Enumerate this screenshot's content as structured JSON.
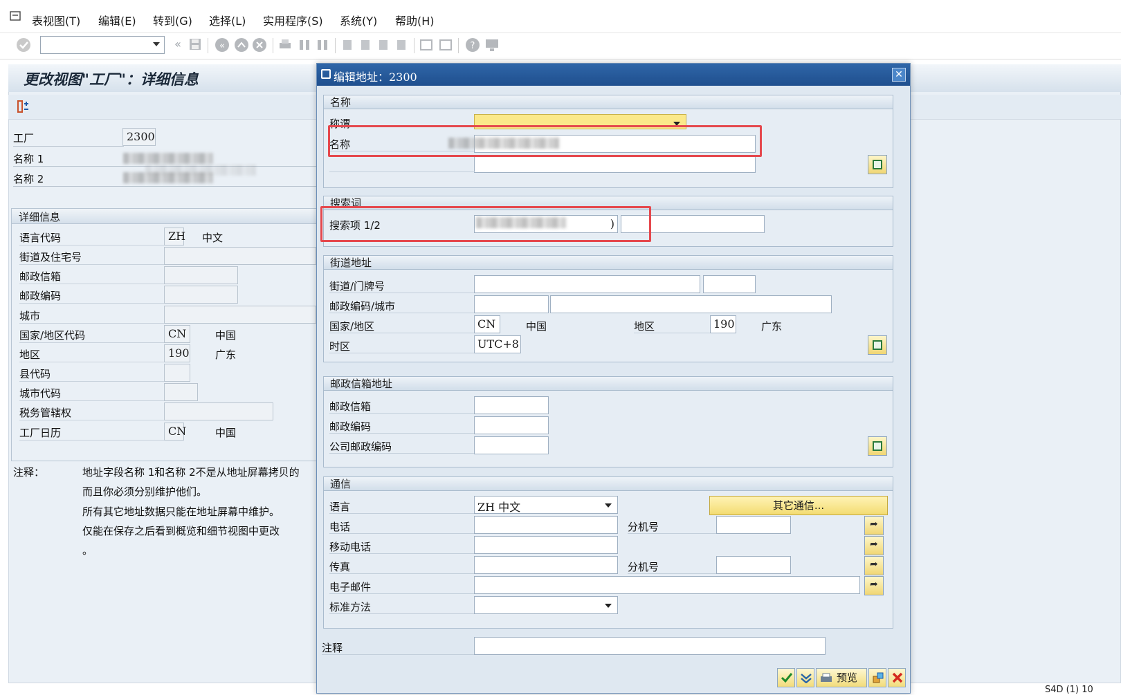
{
  "menubar": {
    "items": [
      "表视图(T)",
      "编辑(E)",
      "转到(G)",
      "选择(L)",
      "实用程序(S)",
      "系统(Y)",
      "帮助(H)"
    ]
  },
  "main": {
    "title": "更改视图\"工厂\"：详细信息",
    "plant_label": "工厂",
    "plant_value": "2300",
    "name1_label": "名称 1",
    "name2_label": "名称 2",
    "details": {
      "title": "详细信息",
      "language_label": "语言代码",
      "language_code": "ZH",
      "language_name": "中文",
      "street_label": "街道及住宅号",
      "pobox_label": "邮政信箱",
      "postal_label": "邮政编码",
      "city_label": "城市",
      "country_label": "国家/地区代码",
      "country_code": "CN",
      "country_name": "中国",
      "region_label": "地区",
      "region_code": "190",
      "region_name": "广东",
      "county_label": "县代码",
      "citycode_label": "城市代码",
      "tax_label": "税务管辖权",
      "calendar_label": "工厂日历",
      "calendar_code": "CN",
      "calendar_name": "中国"
    },
    "note_label": "注释：",
    "note_lines": [
      "地址字段名称 1和名称 2不是从地址屏幕拷贝的",
      "而且你必须分别维护他们。",
      "所有其它地址数据只能在地址屏幕中维护。",
      "仅能在保存之后看到概览和细节视图中更改",
      "。"
    ]
  },
  "dialog": {
    "title": "编辑地址：2300",
    "name_section": {
      "title": "名称",
      "salutation_label": "称谓",
      "name_label": "名称"
    },
    "search_section": {
      "title": "搜索词",
      "search_label": "搜索项 1/2",
      "search_value": ")"
    },
    "street_section": {
      "title": "街道地址",
      "street_label": "街道/门牌号",
      "postal_city_label": "邮政编码/城市",
      "country_label": "国家/地区",
      "country_code": "CN",
      "country_name": "中国",
      "region_label": "地区",
      "region_code": "190",
      "region_name": "广东",
      "timezone_label": "时区",
      "timezone_value": "UTC+8"
    },
    "pobox_section": {
      "title": "邮政信箱地址",
      "pobox_label": "邮政信箱",
      "postal_label": "邮政编码",
      "company_postal_label": "公司邮政编码"
    },
    "comm_section": {
      "title": "通信",
      "language_label": "语言",
      "language_value": "ZH 中文",
      "other_comm_button": "其它通信...",
      "phone_label": "电话",
      "ext_label": "分机号",
      "mobile_label": "移动电话",
      "fax_label": "传真",
      "fax_ext_label": "分机号",
      "email_label": "电子邮件",
      "method_label": "标准方法"
    },
    "remark_label": "注释",
    "footer": {
      "preview_label": "预览"
    }
  },
  "status_bar": {
    "text": "S4D (1) 10"
  }
}
